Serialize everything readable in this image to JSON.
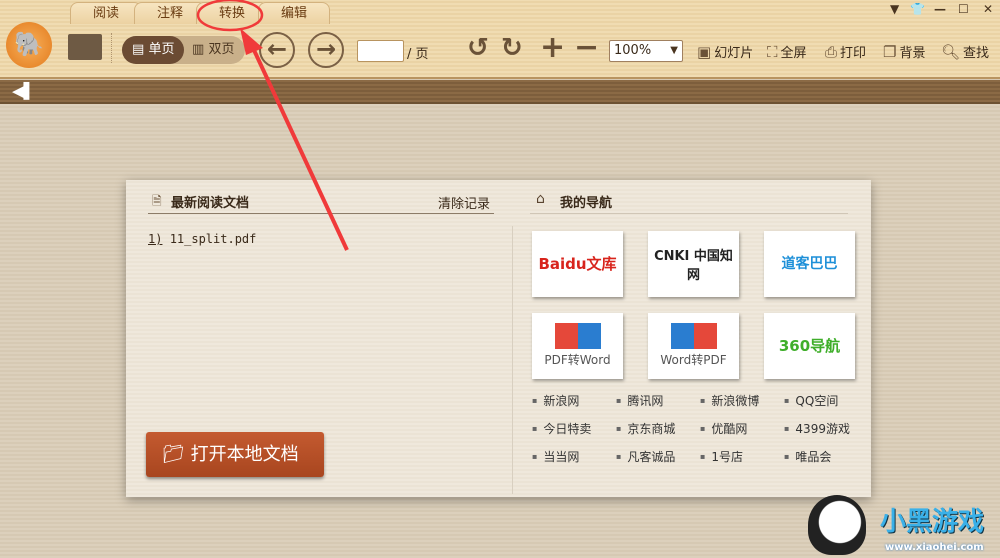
{
  "tabs": [
    "阅读",
    "注释",
    "转换",
    "编辑"
  ],
  "toolbar": {
    "single_page": "单页",
    "double_page": "双页",
    "page_suffix": "/ 页",
    "page_value": "",
    "zoom": "100%",
    "slideshow": "幻灯片",
    "fullscreen": "全屏",
    "print": "打印",
    "background": "背景",
    "find": "查找"
  },
  "recent": {
    "title": "最新阅读文档",
    "clear": "清除记录",
    "items": [
      {
        "index": "1)",
        "name": "11_split.pdf"
      }
    ]
  },
  "nav": {
    "title": "我的导航",
    "tiles": [
      "Baidu文库",
      "CNKI 中国知网",
      "道客巴巴",
      "PDF转Word",
      "Word转PDF",
      "360导航"
    ],
    "links": [
      "新浪网",
      "腾讯网",
      "新浪微博",
      "QQ空间",
      "今日特卖",
      "京东商城",
      "优酷网",
      "4399游戏",
      "当当网",
      "凡客诚品",
      "1号店",
      "唯品会"
    ]
  },
  "open_button": "打开本地文档",
  "watermark": {
    "text": "小黑游戏",
    "url": "www.xiaohei.com"
  },
  "colors": {
    "accent": "#b5502a",
    "annotation": "#f03a3a"
  }
}
